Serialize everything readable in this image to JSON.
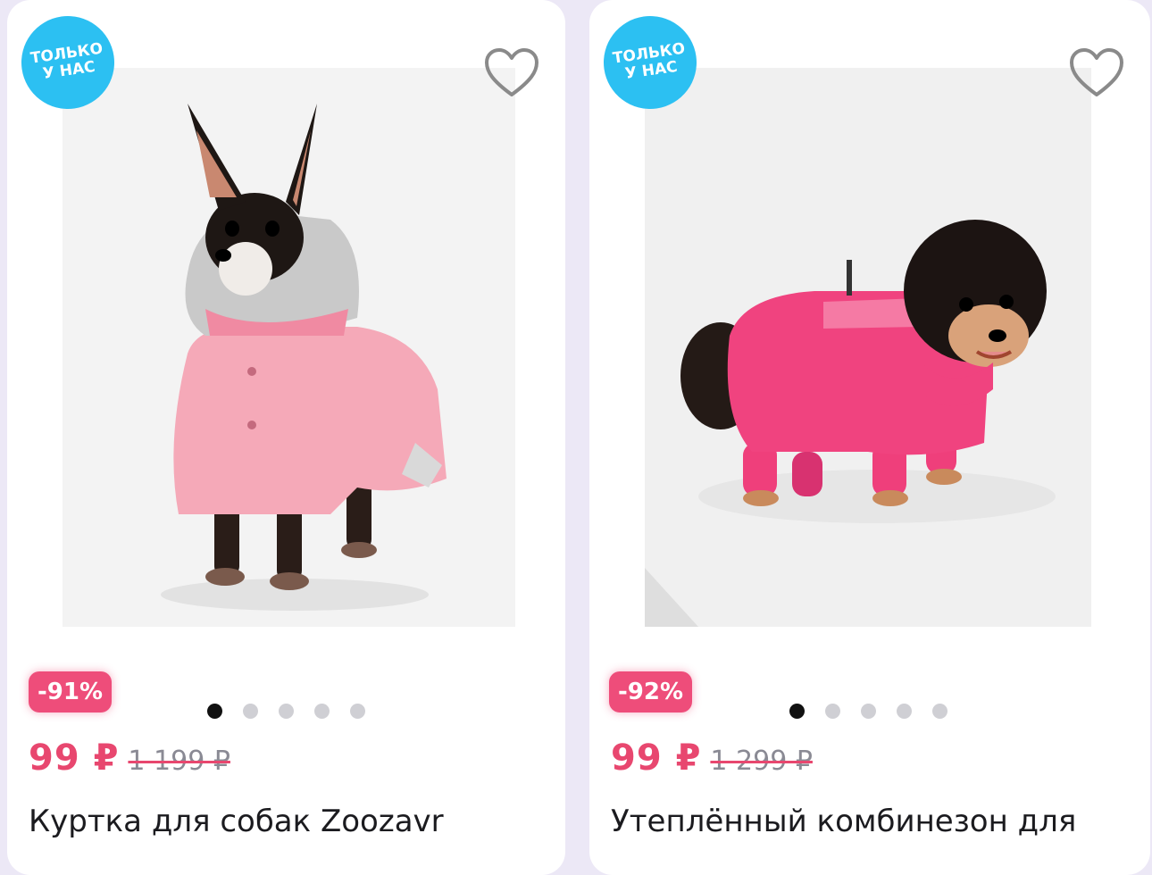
{
  "products": [
    {
      "badge": "ТОЛЬКО\nУ НАС",
      "discount": "-91%",
      "price": "99 ₽",
      "old_price": "1 199 ₽",
      "title": "Куртка для собак Zoozavr",
      "image_dots": 5,
      "active_dot": 0
    },
    {
      "badge": "ТОЛЬКО\nУ НАС",
      "discount": "-92%",
      "price": "99 ₽",
      "old_price": "1 299 ₽",
      "title": "Утеплённый комбинезон для",
      "image_dots": 5,
      "active_dot": 0
    }
  ],
  "colors": {
    "badge": "#2cc0f2",
    "discount": "#ee4d7a",
    "price": "#e8476f",
    "background": "#ece8f6"
  },
  "icons": {
    "favorite": "heart-outline-icon"
  }
}
